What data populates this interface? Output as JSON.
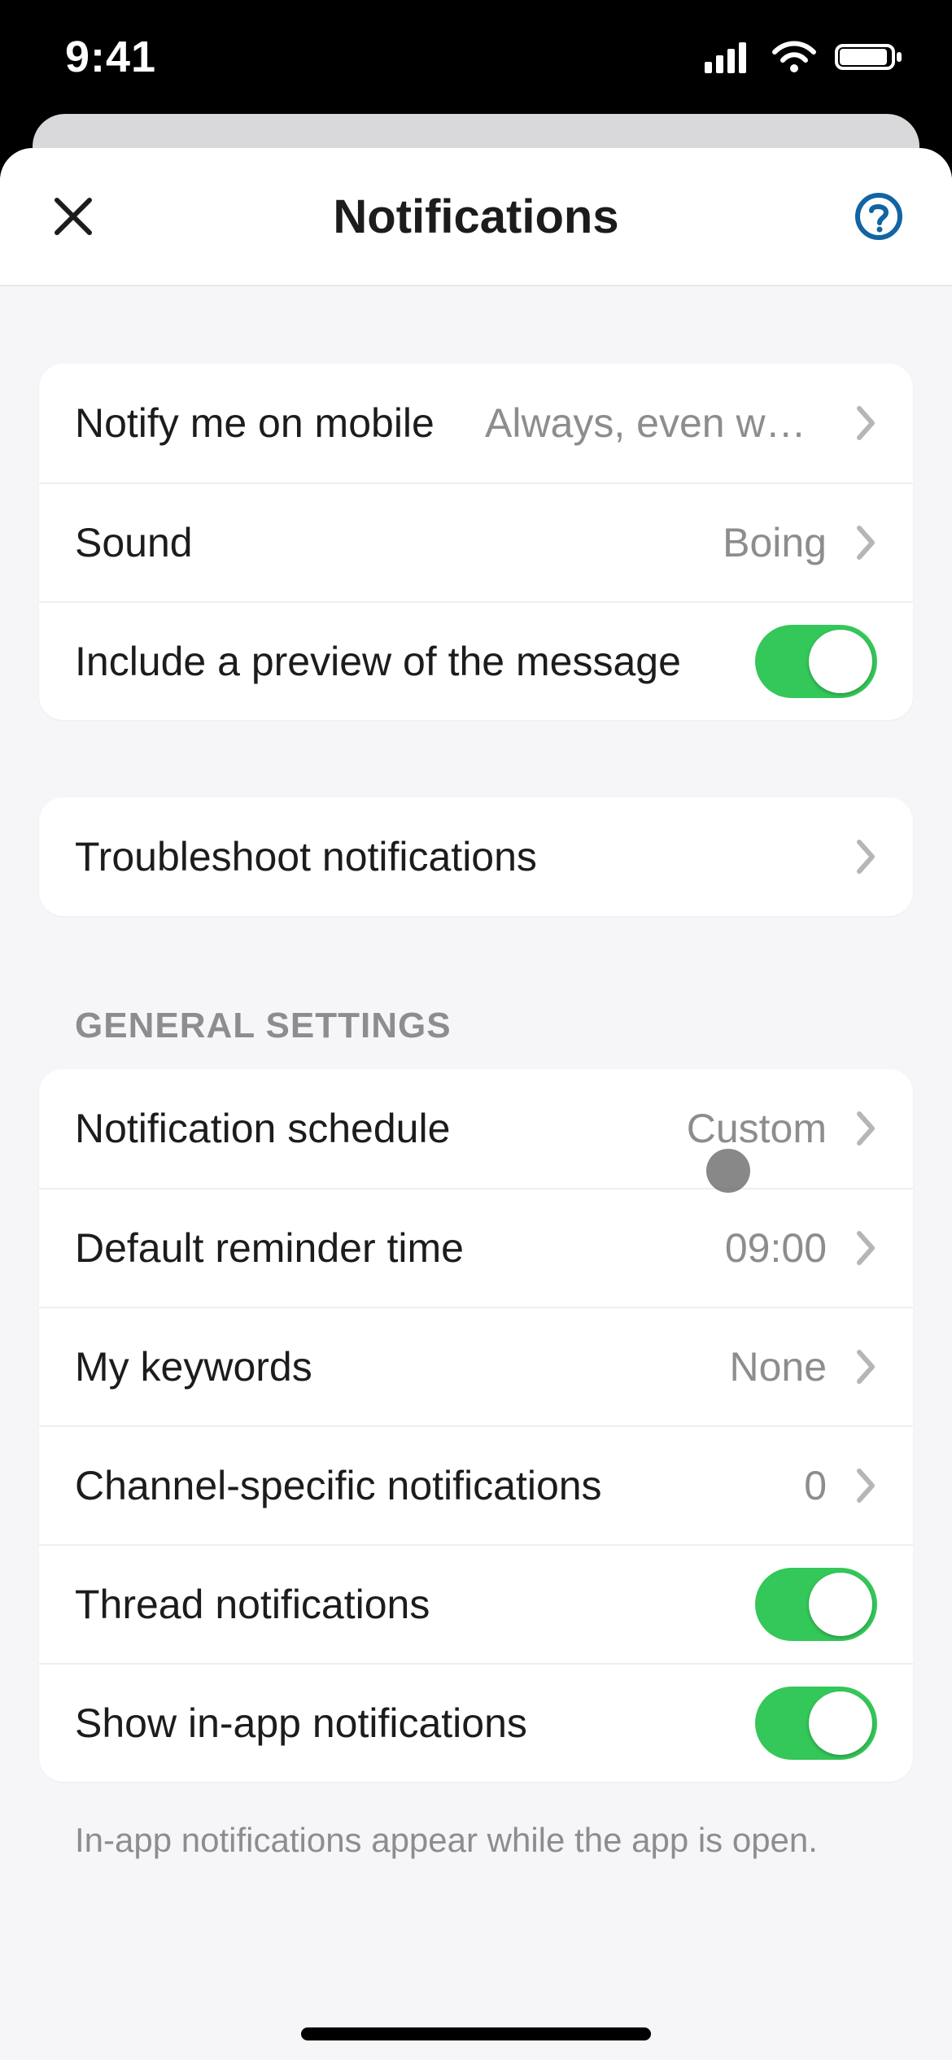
{
  "status": {
    "time": "9:41"
  },
  "header": {
    "title": "Notifications"
  },
  "section_general_title": "GENERAL SETTINGS",
  "rows": {
    "notify_mobile": {
      "label": "Notify me on mobile",
      "value": "Always, even wh…"
    },
    "sound": {
      "label": "Sound",
      "value": "Boing"
    },
    "preview": {
      "label": "Include a preview of the message",
      "on": true
    },
    "troubleshoot": {
      "label": "Troubleshoot notifications"
    },
    "schedule": {
      "label": "Notification schedule",
      "value": "Custom"
    },
    "reminder": {
      "label": "Default reminder time",
      "value": "09:00"
    },
    "keywords": {
      "label": "My keywords",
      "value": "None"
    },
    "channel_specific": {
      "label": "Channel-specific notifications",
      "value": "0"
    },
    "threads": {
      "label": "Thread notifications",
      "on": true
    },
    "inapp": {
      "label": "Show in-app notifications",
      "on": true
    }
  },
  "footer_note": "In-app notifications appear while the app is open."
}
